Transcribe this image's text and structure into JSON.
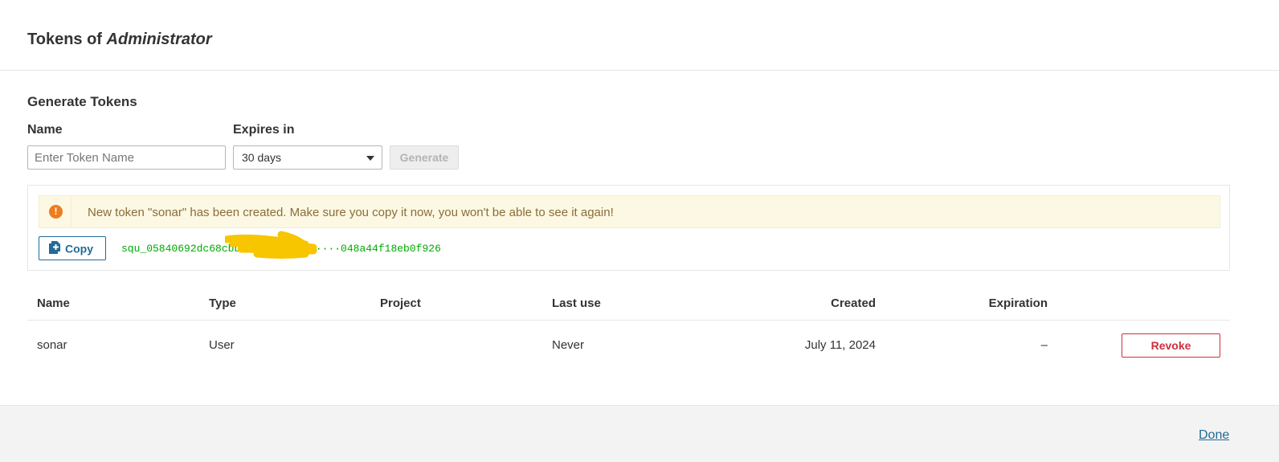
{
  "modal": {
    "title_prefix": "Tokens of",
    "user_name": "Administrator"
  },
  "generate": {
    "section_title": "Generate Tokens",
    "name_label": "Name",
    "name_placeholder": "Enter Token Name",
    "name_value": "",
    "expires_label": "Expires in",
    "expires_value": "30 days",
    "generate_label": "Generate"
  },
  "new_token": {
    "alert_text": "New token \"sonar\" has been created. Make sure you copy it now, you won't be able to see it again!",
    "copy_label": "Copy",
    "token_value": "squ_05840692dc68cbb8···············048a44f18eb0f926",
    "alert_icon": "!"
  },
  "table": {
    "headers": [
      "Name",
      "Type",
      "Project",
      "Last use",
      "Created",
      "Expiration"
    ],
    "rows": [
      {
        "name": "sonar",
        "type": "User",
        "project": "",
        "last_use": "Never",
        "created": "July 11, 2024",
        "expiration": "–",
        "action_label": "Revoke"
      }
    ]
  },
  "footer": {
    "done_label": "Done"
  },
  "colors": {
    "link_blue": "#236a97",
    "revoke_red": "#d02f3a",
    "token_green": "#00aa00",
    "warning_orange": "#ed7d20",
    "alert_bg": "#fcf8e3",
    "redaction_yellow": "#f7c600"
  }
}
